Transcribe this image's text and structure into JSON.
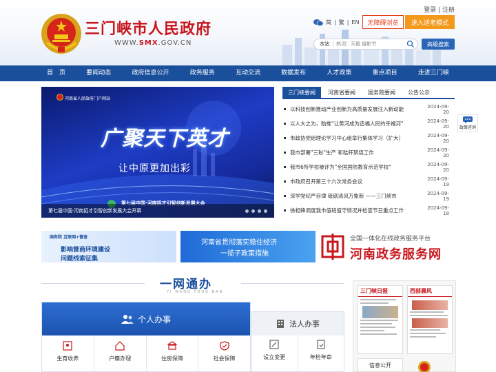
{
  "header": {
    "site_title": "三门峡市人民政府",
    "domain_prefix": "WWW.",
    "domain_mid": "SMX",
    "domain_suffix": ".GOV.CN",
    "login": "登录",
    "separator": "|",
    "register": "注册",
    "lang_simplified": "简",
    "lang_traditional": "繁",
    "lang_english": "EN",
    "accessible_browse": "无障碍浏览",
    "elder_mode": "进入适老模式",
    "search_scope": "本站",
    "search_placeholder": "热词：天鹅 摄影节",
    "advanced_search": "高级搜索"
  },
  "nav": {
    "items": [
      "首　页",
      "要闻动态",
      "政府信息公开",
      "政务服务",
      "互动交流",
      "数据发布",
      "人才政策",
      "重点项目",
      "走进三门峡"
    ]
  },
  "banner": {
    "portal": "河南省人民政府门户网站",
    "headline": "广聚天下英才",
    "subline": "让中原更加出彩",
    "event": "第七届中国·河南招才引智创新发展大会",
    "caption": "第七届中国·河南招才引智创新发展大会开幕"
  },
  "news": {
    "tabs": [
      "三门峡要闻",
      "河南省要闻",
      "国务院要闻",
      "公告公示"
    ],
    "items": [
      {
        "title": "以科技创新推动产业创新为高质量发展注入新动能",
        "date": "2024-09-20"
      },
      {
        "title": "以人大之为，助推\"让黄河成为造福人民的幸福河\"",
        "date": "2024-09-20"
      },
      {
        "title": "市政协党组理论学习中心组举行集体学习（扩大）",
        "date": "2024-09-20"
      },
      {
        "title": "我市部署\"三秋\"生产 和秸秆禁烧工作",
        "date": "2024-09-20"
      },
      {
        "title": "我市6所学校被评为\"全国国防教育示范学校\"",
        "date": "2024-09-20"
      },
      {
        "title": "市政府召开第三十六次常务会议",
        "date": "2024-09-19"
      },
      {
        "title": "深学党纪严自律 砥砺清风万象新 ——三门峡市",
        "date": "2024-09-19"
      },
      {
        "title": "徐相锋调度我市值班值守情况并检查节日重点工作",
        "date": "2024-09-18"
      }
    ]
  },
  "side_float": {
    "label": "政策咨询"
  },
  "sub_banners": {
    "b1_tag": "国务院 互联网+督查",
    "b1_line1": "影响营商环境建设",
    "b1_line2": "问题线索征集",
    "b2_line1": "河南省贯彻落实稳住经济",
    "b2_line2": "一揽子政策措施",
    "gov_small": "全国一体化在线政务服务平台",
    "gov_big": "河南政务服务网"
  },
  "onestop": {
    "title": "一网通办",
    "subtitle": "YI WANG TONG BAN"
  },
  "personal": {
    "title": "个人办事",
    "items": [
      "生育收养",
      "户籍办理",
      "住房保障",
      "社会保障"
    ]
  },
  "legal": {
    "title": "法人办事",
    "items": [
      "设立变更",
      "年检年审"
    ]
  },
  "papers": {
    "paper1": "三门峡日报",
    "paper2": "西部晨风",
    "info_open": "信息公开"
  },
  "colors": {
    "brand_red": "#c8161d",
    "nav_blue": "#1a4f9c",
    "accent_orange": "#f39a1d"
  }
}
